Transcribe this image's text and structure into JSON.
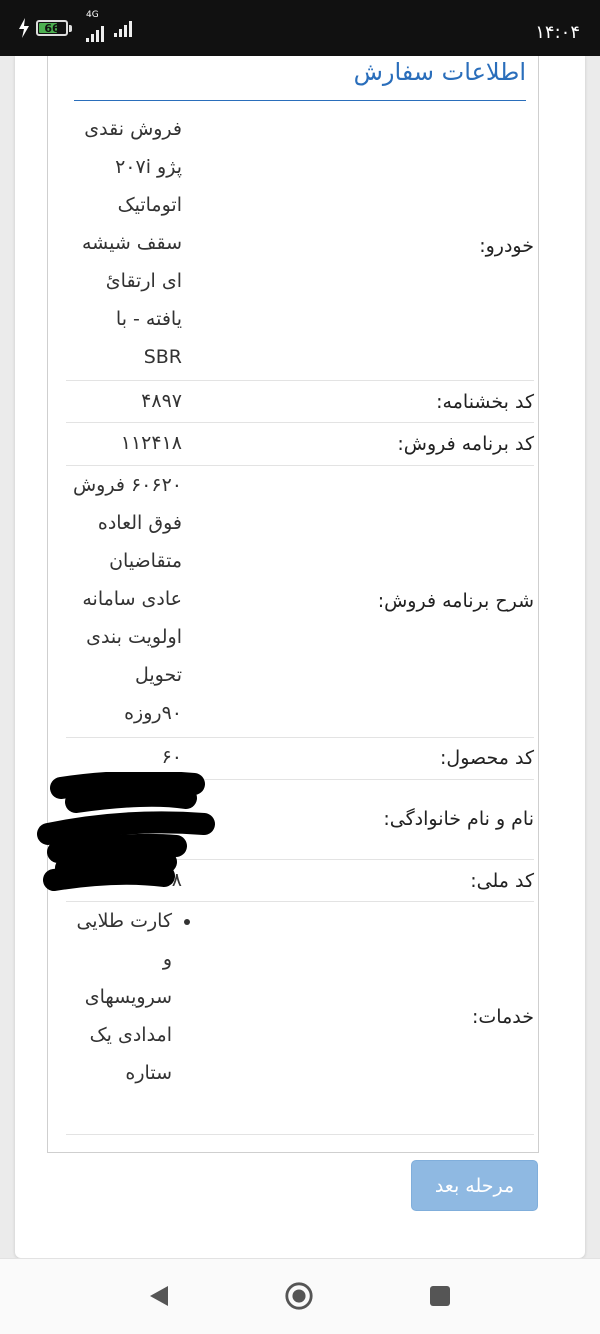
{
  "status_bar": {
    "time": "۱۴:۰۴",
    "battery_level": "66",
    "network_type": "4G",
    "icons": [
      "charging-bolt-icon",
      "battery-icon",
      "signal-4g-icon",
      "signal-icon"
    ]
  },
  "page": {
    "title": "اطلاعات سفارش",
    "accent_color": "#2a6ebb"
  },
  "order_info": {
    "car": {
      "label": "خودرو:",
      "value": "فروش نقدی پژو ۲۰۷i اتوماتیک سقف شیشه ای ارتقائ یافته - با SBR"
    },
    "circular_code": {
      "label": "کد بخشنامه:",
      "value": "۴۸۹۷"
    },
    "sales_program_code": {
      "label": "کد برنامه فروش:",
      "value": "۱۱۲۴۱۸"
    },
    "sales_program_desc": {
      "label": "شرح برنامه فروش:",
      "value": "۶۰۶۲۰ فروش فوق العاده متقاضیان عادی سامانه اولویت بندی تحویل ۹۰روزه"
    },
    "product_code": {
      "label": "کد محصول:",
      "value": "۶۰"
    },
    "full_name": {
      "label": "نام و نام خانوادگی:",
      "value": ""
    },
    "national_id": {
      "label": "کد ملی:",
      "value": "۸"
    },
    "services": {
      "label": "خدمات:",
      "items": [
        "کارت طلایی و سرویسهای امدادی یک ستاره"
      ]
    }
  },
  "actions": {
    "next_label": "مرحله بعد",
    "next_color": "#8fb9e2"
  },
  "nav_bar": {
    "icons": [
      "back-icon",
      "home-icon",
      "recents-icon"
    ]
  }
}
